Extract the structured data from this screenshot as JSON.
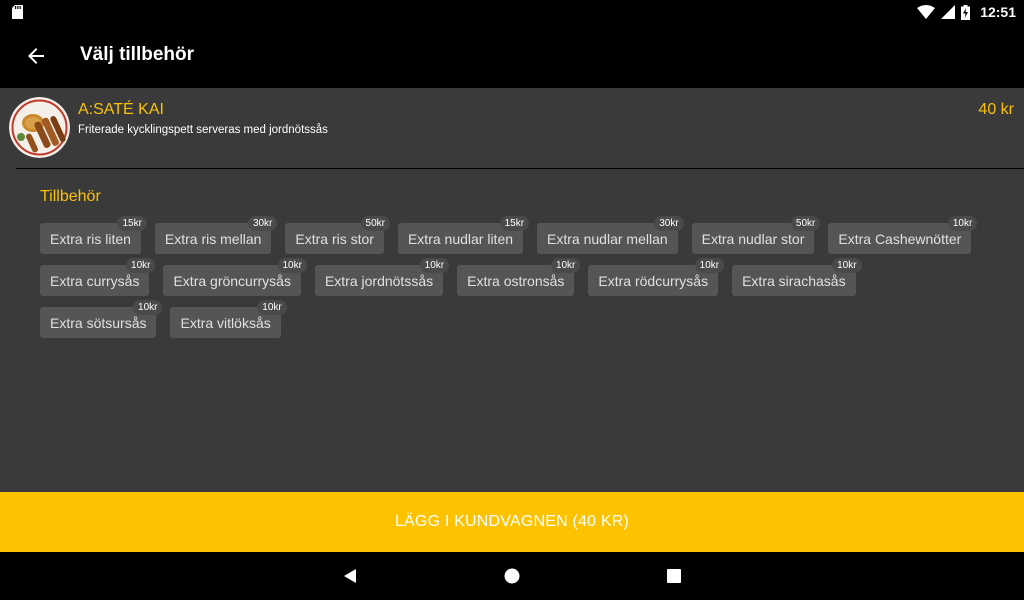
{
  "status": {
    "time": "12:51"
  },
  "appbar": {
    "title": "Välj tillbehör"
  },
  "product": {
    "name": "A:SATÉ KAI",
    "description": "Friterade kycklingspett serveras med jordnötssås",
    "price": "40 kr"
  },
  "addons": {
    "title": "Tillbehör",
    "rows": [
      [
        {
          "label": "Extra ris liten",
          "price": "15kr"
        },
        {
          "label": "Extra ris mellan",
          "price": "30kr"
        },
        {
          "label": "Extra ris stor",
          "price": "50kr"
        },
        {
          "label": "Extra nudlar liten",
          "price": "15kr"
        },
        {
          "label": "Extra nudlar mellan",
          "price": "30kr"
        },
        {
          "label": "Extra nudlar stor",
          "price": "50kr"
        },
        {
          "label": "Extra Cashewnötter",
          "price": "10kr"
        }
      ],
      [
        {
          "label": "Extra currysås",
          "price": "10kr"
        },
        {
          "label": "Extra gröncurrysås",
          "price": "10kr"
        },
        {
          "label": "Extra jordnötssås",
          "price": "10kr"
        },
        {
          "label": "Extra ostronsås",
          "price": "10kr"
        },
        {
          "label": "Extra rödcurrysås",
          "price": "10kr"
        },
        {
          "label": "Extra sirachasås",
          "price": "10kr"
        }
      ],
      [
        {
          "label": "Extra sötsursås",
          "price": "10kr"
        },
        {
          "label": "Extra vitlöksås",
          "price": "10kr"
        }
      ]
    ]
  },
  "cart_button": {
    "label": "LÄGG I KUNDVAGNEN (40 KR)"
  },
  "icons": {
    "sd_card": "sd-card-icon",
    "wifi": "wifi-icon",
    "signal": "cell-signal-icon",
    "battery": "battery-charging-icon",
    "back": "arrow-left-icon",
    "nav_back": "triangle-back-icon",
    "nav_home": "circle-home-icon",
    "nav_recents": "square-recents-icon"
  },
  "colors": {
    "accent": "#f9c10a",
    "cta": "#fec300",
    "background": "#3a3a3a",
    "chip": "#555555"
  }
}
